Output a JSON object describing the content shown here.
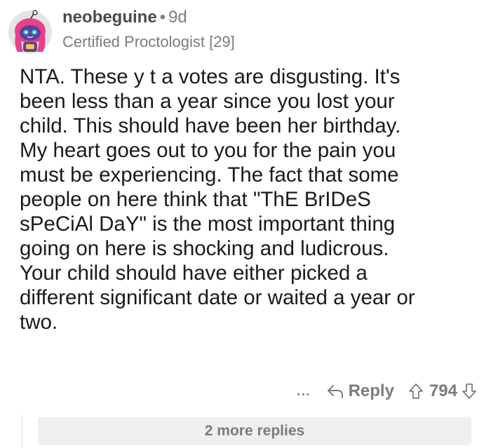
{
  "comment": {
    "username": "neobeguine",
    "separator": "•",
    "age": "9d",
    "flair": "Certified Proctologist [29]",
    "body": "NTA.  These y t a votes are disgusting.  It's\nbeen less than  a year since you lost your\nchild.  This should have been her birthday.\nMy heart goes out to you for the pain you\nmust be experiencing. The fact that some\npeople on here think that \"ThE BrIDeS\nsPeCiAl DaY\" is the most important thing\ngoing on here is shocking and ludicrous.\nYour child should have either picked a\ndifferent significant date or waited a year or\ntwo.",
    "actions": {
      "more_label": "...",
      "reply_label": "Reply",
      "score": "794"
    },
    "more_replies_label": "2 more replies"
  },
  "icons": {
    "avatar": "snoo-avatar",
    "reply": "reply-arrow-icon",
    "upvote": "upvote-icon",
    "downvote": "downvote-icon"
  },
  "colors": {
    "avatar_bg": "#e4e4e4",
    "avatar_hair": "#e8408a",
    "avatar_face": "#5a3fa0",
    "avatar_accent": "#2ec4c6",
    "muted_text": "#7c7c7c",
    "more_replies_bg": "#edeff1"
  }
}
